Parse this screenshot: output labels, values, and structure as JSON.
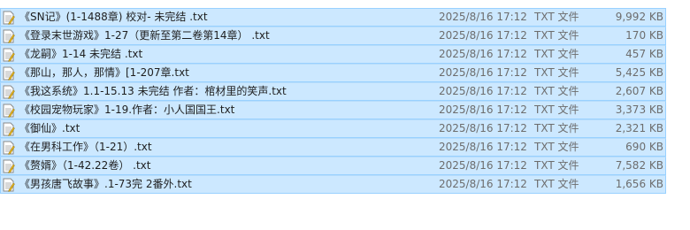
{
  "colors": {
    "selection_bg": "#cce8ff",
    "selection_border": "#99d1ff"
  },
  "files": [
    {
      "name": "《SN记》(1-1488章) 校对- 未完结 .txt",
      "date": "2025/8/16 17:12",
      "type": "TXT 文件",
      "size": "9,992 KB",
      "icon": "text-file-icon"
    },
    {
      "name": "《登录末世游戏》1-27（更新至第二卷第14章） .txt",
      "date": "2025/8/16 17:12",
      "type": "TXT 文件",
      "size": "170 KB",
      "icon": "text-file-icon"
    },
    {
      "name": "《龙嗣》1-14 未完结 .txt",
      "date": "2025/8/16 17:12",
      "type": "TXT 文件",
      "size": "457 KB",
      "icon": "text-file-icon"
    },
    {
      "name": "《那山，那人，那情》[1-207章.txt",
      "date": "2025/8/16 17:12",
      "type": "TXT 文件",
      "size": "5,425 KB",
      "icon": "text-file-icon"
    },
    {
      "name": "《我这系统》1.1-15.13 未完结 作者：棺材里的笑声.txt",
      "date": "2025/8/16 17:12",
      "type": "TXT 文件",
      "size": "2,607 KB",
      "icon": "text-file-icon"
    },
    {
      "name": "《校园宠物玩家》1-19.作者：小人国国王.txt",
      "date": "2025/8/16 17:12",
      "type": "TXT 文件",
      "size": "3,373 KB",
      "icon": "text-file-icon"
    },
    {
      "name": "《御仙》.txt",
      "date": "2025/8/16 17:12",
      "type": "TXT 文件",
      "size": "2,321 KB",
      "icon": "text-file-icon"
    },
    {
      "name": "《在男科工作》（1-21）.txt",
      "date": "2025/8/16 17:12",
      "type": "TXT 文件",
      "size": "690 KB",
      "icon": "text-file-icon"
    },
    {
      "name": "《赘婿》（1-42.22卷） .txt",
      "date": "2025/8/16 17:12",
      "type": "TXT 文件",
      "size": "7,582 KB",
      "icon": "text-file-icon"
    },
    {
      "name": "《男孩唐飞故事》.1-73完 2番外.txt",
      "date": "2025/8/16 17:12",
      "type": "TXT 文件",
      "size": "1,656 KB",
      "icon": "text-file-icon"
    }
  ]
}
